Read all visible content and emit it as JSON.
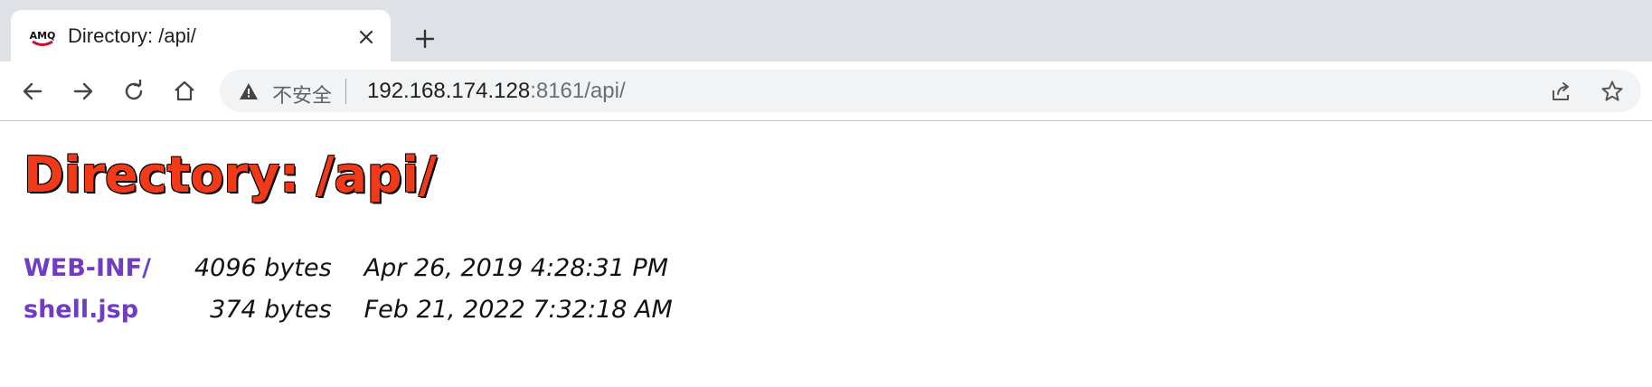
{
  "tab": {
    "favicon_text": "AMQ",
    "title": "Directory: /api/"
  },
  "address_bar": {
    "security_label": "不安全",
    "url_host": "192.168.174.128",
    "url_rest": ":8161/api/"
  },
  "page": {
    "heading": "Directory: /api/",
    "entries": [
      {
        "name": "WEB-INF/",
        "size": "4096 bytes",
        "date": "Apr 26, 2019 4:28:31 PM"
      },
      {
        "name": "shell.jsp",
        "size": "374 bytes",
        "date": "Feb 21, 2022 7:32:18 AM"
      }
    ]
  },
  "colors": {
    "tabbar_bg": "#dee1e6",
    "heading": "#f23a18",
    "link": "#6f3cc3"
  }
}
